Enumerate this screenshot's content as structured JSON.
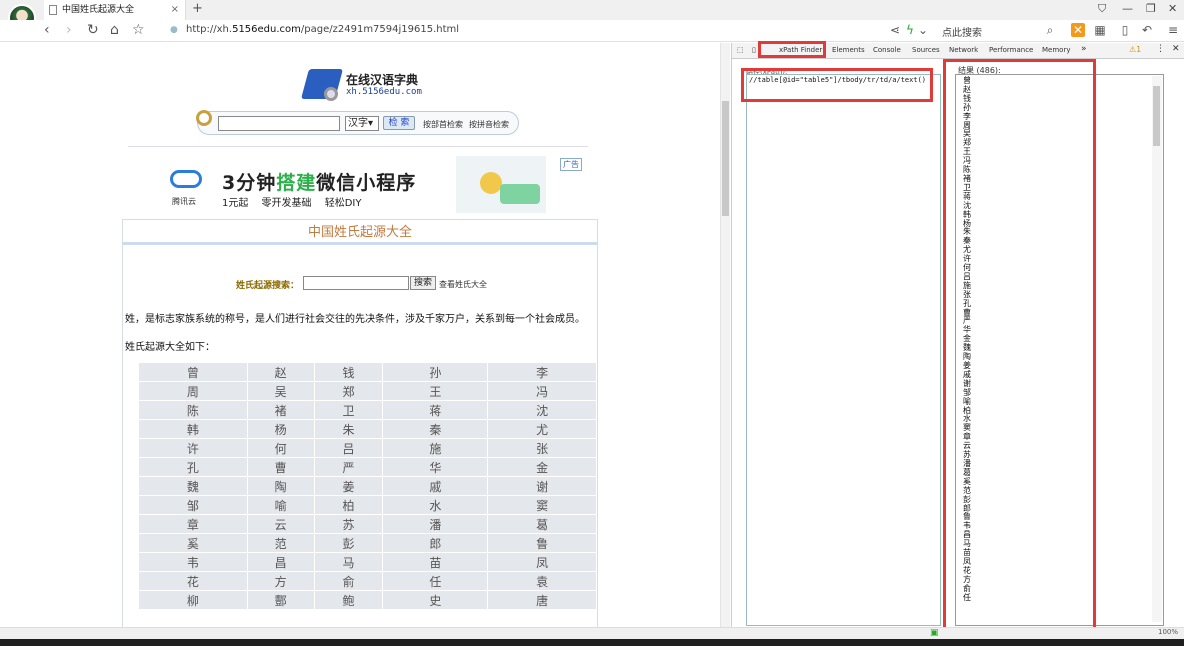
{
  "browser": {
    "tab_title": "中国姓氏起源大全",
    "tab_close": "×",
    "new_tab": "+",
    "url_prefix": "http://xh.",
    "url_domain": "5156edu.com",
    "url_rest": "/page/z2491m7594j19615.html",
    "search_placeholder": "点此搜索"
  },
  "site": {
    "logo_title": "在线汉语字典",
    "logo_sub": "xh.5156edu.com",
    "lang_select": "汉字",
    "search_button": "检 索",
    "link_bushou": "按部首检索",
    "link_pinyin": "按拼音检索"
  },
  "ad": {
    "brand": "腾讯云",
    "headline_a": "3分钟",
    "headline_b": "搭建",
    "headline_c": "微信小程序",
    "subline": "1元起 零开发基础 轻松DIY",
    "tag": "广告"
  },
  "content": {
    "panel_title": "中国姓氏起源大全",
    "search_label": "姓氏起源搜索：",
    "search_btn": "搜索",
    "view_all": "查看姓氏大全",
    "para1": "姓，是标志家族系统的称号，是人们进行社会交往的先决条件，涉及千家万户，关系到每一个社会成员。",
    "para2": "姓氏起源大全如下："
  },
  "surname_rows": [
    [
      "曾",
      "赵",
      "钱",
      "孙",
      "李"
    ],
    [
      "周",
      "吴",
      "郑",
      "王",
      "冯"
    ],
    [
      "陈",
      "褚",
      "卫",
      "蒋",
      "沈"
    ],
    [
      "韩",
      "杨",
      "朱",
      "秦",
      "尤"
    ],
    [
      "许",
      "何",
      "吕",
      "施",
      "张"
    ],
    [
      "孔",
      "曹",
      "严",
      "华",
      "金"
    ],
    [
      "魏",
      "陶",
      "姜",
      "戚",
      "谢"
    ],
    [
      "邹",
      "喻",
      "柏",
      "水",
      "窦"
    ],
    [
      "章",
      "云",
      "苏",
      "潘",
      "葛"
    ],
    [
      "奚",
      "范",
      "彭",
      "郎",
      "鲁"
    ],
    [
      "韦",
      "昌",
      "马",
      "苗",
      "凤"
    ],
    [
      "花",
      "方",
      "俞",
      "任",
      "袁"
    ],
    [
      "柳",
      "酆",
      "鲍",
      "史",
      "唐"
    ]
  ],
  "devtools": {
    "tabs": [
      "xPath Finder",
      "Elements",
      "Console",
      "Sources",
      "Network",
      "Performance",
      "Memory"
    ],
    "more": "»",
    "warn_count": "1",
    "xpath_label": "路径(xPath):",
    "xpath_expr": "//table[@id=\"table5\"]/tbody/tr/td/a/text()",
    "result_label": "结果 (486):",
    "results": "曾赵钱孙李周吴郑王冯陈褚卫蒋沈韩杨朱秦尤许何吕施张孔曹严华金魏陶姜戚谢邹喻柏水窦章云苏潘葛奚范彭郎鲁韦昌马苗凤花方俞任"
  },
  "status": {
    "zoom": "100%"
  },
  "colors": {
    "highlight": "#e13a3a",
    "title_orange": "#c27b40",
    "link_blue": "#1a3f9a"
  }
}
